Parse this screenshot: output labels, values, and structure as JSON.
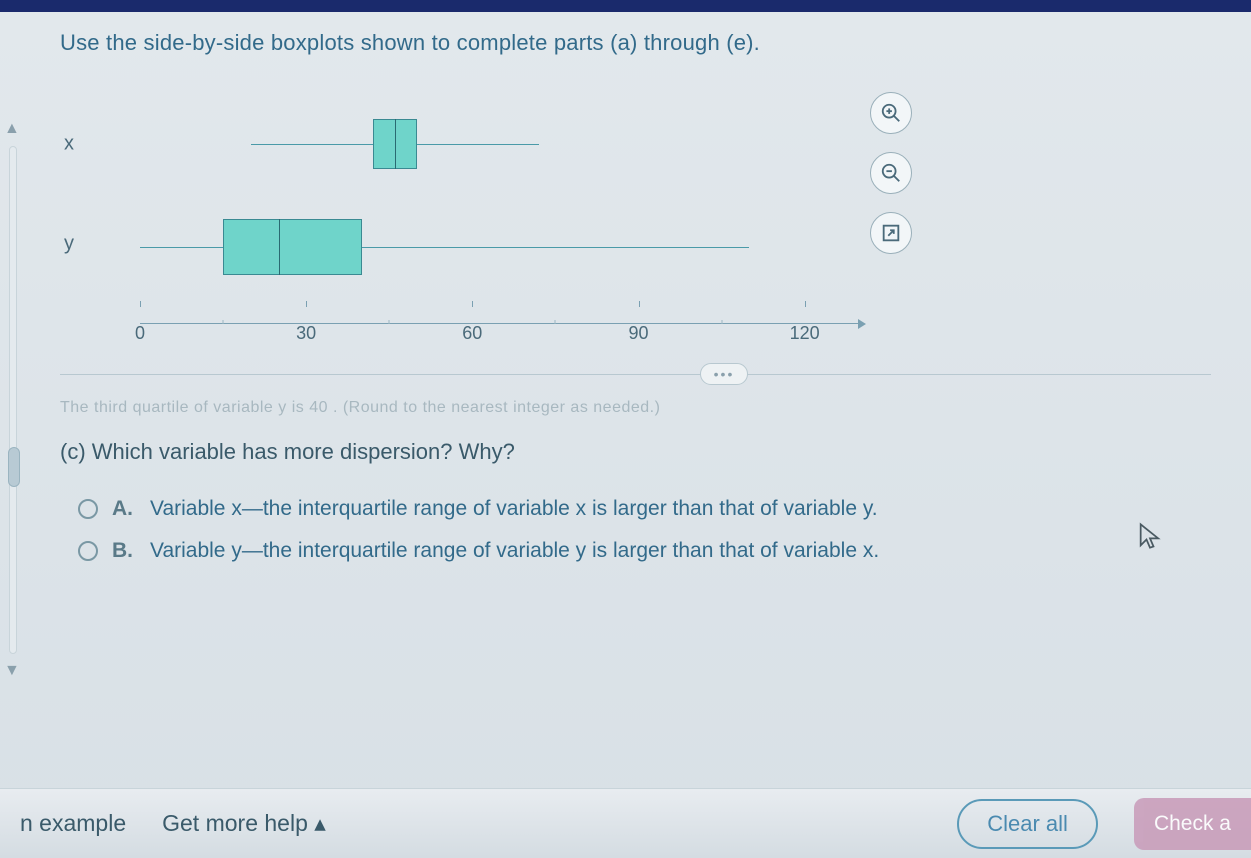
{
  "prompt": "Use the side-by-side boxplots shown to complete parts (a) through (e).",
  "faded_prev": "The third quartile of variable y is 40 . (Round to the nearest integer as needed.)",
  "question_c": "(c) Which variable has more dispersion? Why?",
  "options": {
    "a": {
      "letter": "A.",
      "text": "Variable x—the interquartile range of variable x is larger than that of variable y."
    },
    "b": {
      "letter": "B.",
      "text": "Variable y—the interquartile range of variable y is larger than that of variable x."
    }
  },
  "axis": {
    "ticks": [
      "0",
      "30",
      "60",
      "90",
      "120"
    ]
  },
  "categories": {
    "x": "x",
    "y": "y"
  },
  "buttons": {
    "example": "n example",
    "help": "Get more help",
    "clear": "Clear all",
    "check": "Check a"
  },
  "chart_data": {
    "type": "boxplot",
    "title": "",
    "xlabel": "",
    "ylabel": "",
    "xlim": [
      0,
      130
    ],
    "categories": [
      "x",
      "y"
    ],
    "series": [
      {
        "name": "x",
        "min": 20,
        "q1": 42,
        "median": 46,
        "q3": 50,
        "max": 72
      },
      {
        "name": "y",
        "min": 0,
        "q1": 15,
        "median": 25,
        "q3": 40,
        "max": 110
      }
    ]
  }
}
